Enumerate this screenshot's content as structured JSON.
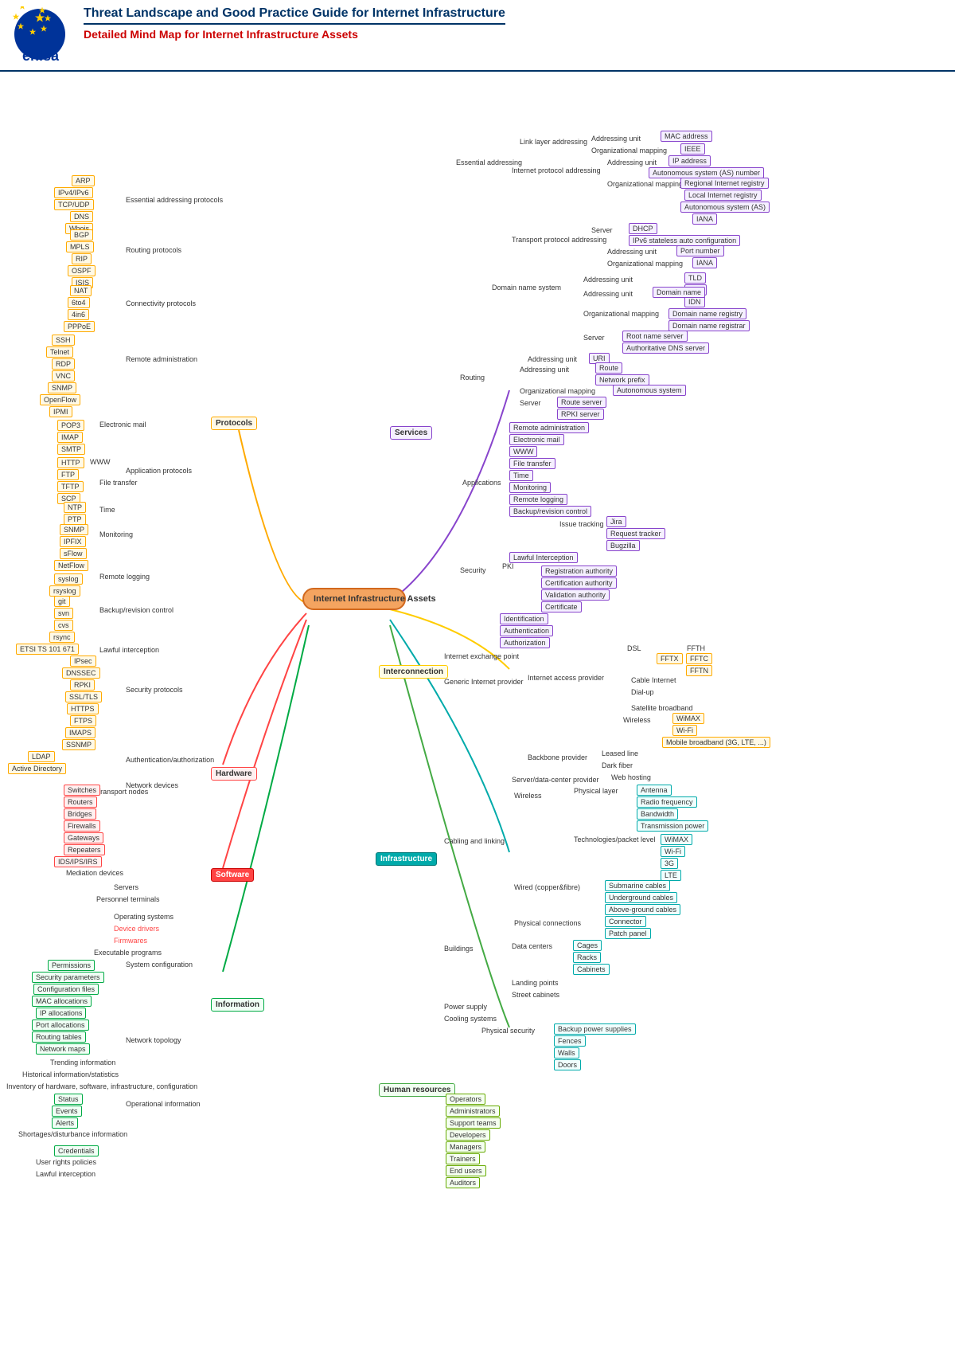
{
  "header": {
    "title": "Threat Landscape and Good Practice Guide for Internet Infrastructure",
    "subtitle": "Detailed Mind Map for Internet Infrastructure Assets"
  },
  "center": "Internet Infrastructure Assets",
  "nodes": {
    "protocols": "Protocols",
    "hardware": "Hardware",
    "software": "Software",
    "information": "Information",
    "services": "Services",
    "interconnection": "Interconnection",
    "infrastructure": "Infrastructure",
    "human_resources": "Human resources"
  }
}
